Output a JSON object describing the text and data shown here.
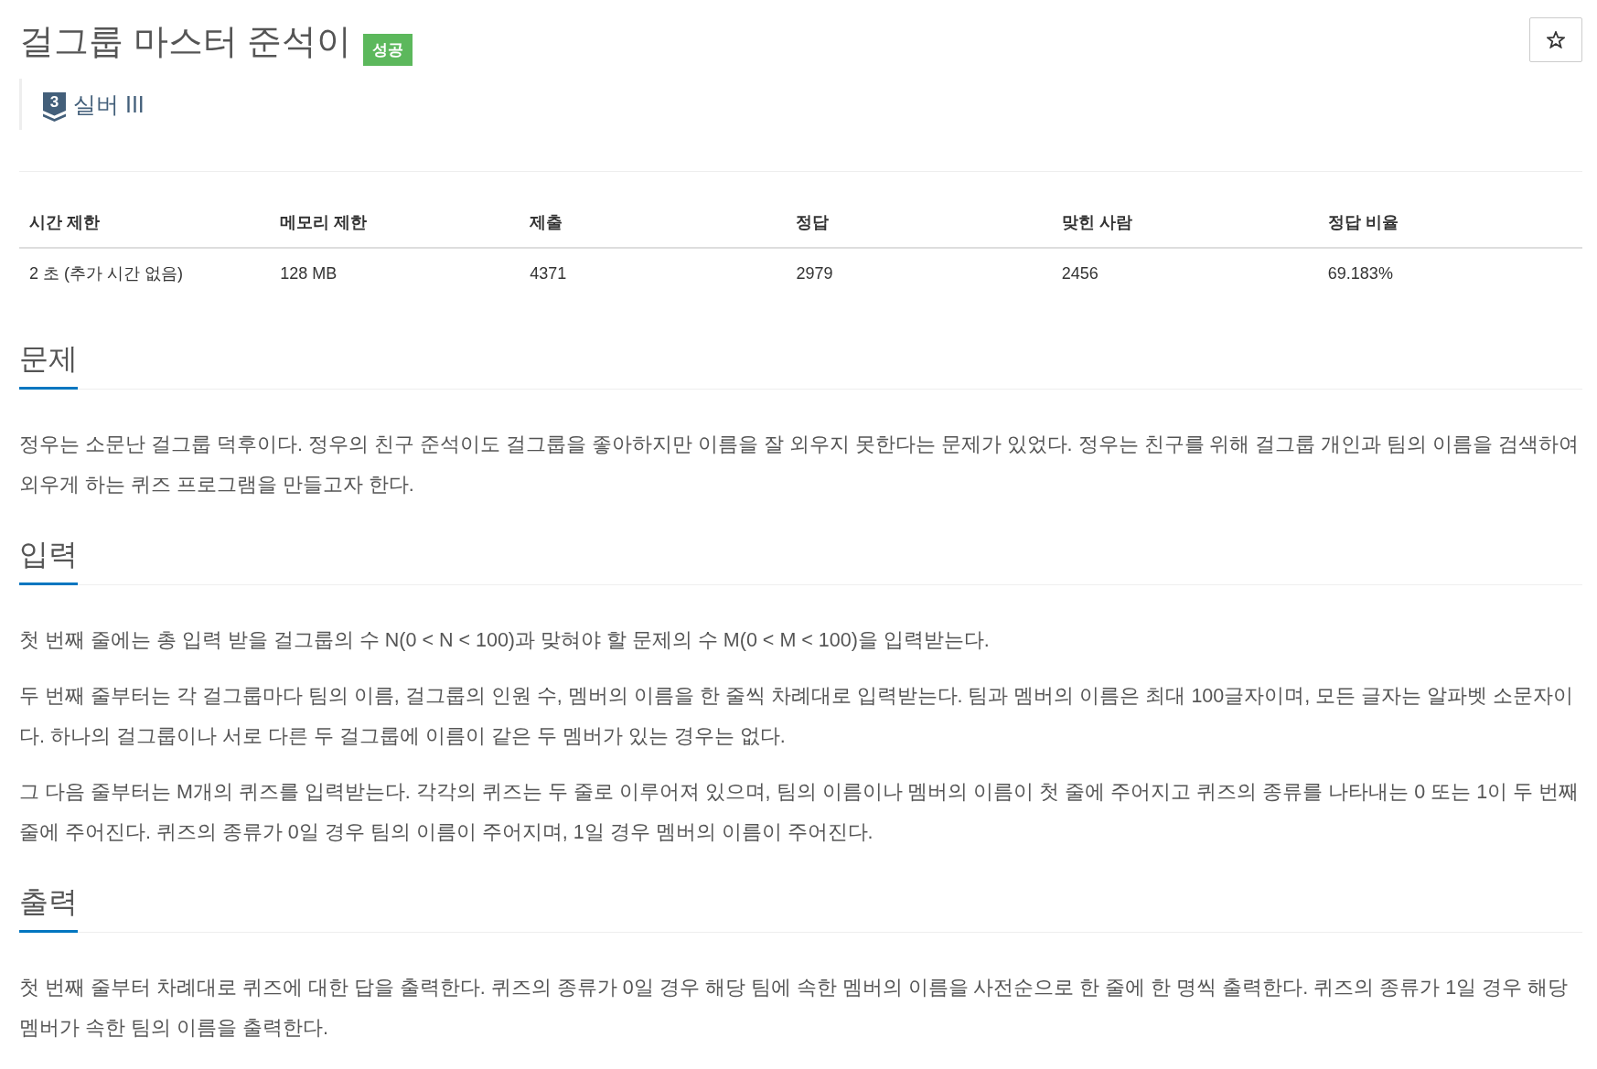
{
  "title": "걸그룹 마스터 준석이",
  "result_badge": "성공",
  "starred": false,
  "tier": {
    "number": "3",
    "label": "실버 III"
  },
  "stats": {
    "columns": [
      "시간 제한",
      "메모리 제한",
      "제출",
      "정답",
      "맞힌 사람",
      "정답 비율"
    ],
    "rows": [
      [
        "2 초 (추가 시간 없음)",
        "128 MB",
        "4371",
        "2979",
        "2456",
        "69.183%"
      ]
    ]
  },
  "sections": [
    {
      "heading": "문제",
      "paragraphs": [
        "정우는 소문난 걸그룹 덕후이다. 정우의 친구 준석이도 걸그룹을 좋아하지만 이름을 잘 외우지 못한다는 문제가 있었다. 정우는 친구를 위해 걸그룹 개인과 팀의 이름을 검색하여 외우게 하는 퀴즈 프로그램을 만들고자 한다."
      ]
    },
    {
      "heading": "입력",
      "paragraphs": [
        "첫 번째 줄에는 총 입력 받을 걸그룹의 수 N(0 < N < 100)과 맞혀야 할 문제의 수 M(0 < M < 100)을 입력받는다.",
        "두 번째 줄부터는 각 걸그룹마다 팀의 이름, 걸그룹의 인원 수, 멤버의 이름을 한 줄씩 차례대로 입력받는다. 팀과 멤버의 이름은 최대 100글자이며, 모든 글자는 알파벳 소문자이다. 하나의 걸그룹이나 서로 다른 두 걸그룹에 이름이 같은 두 멤버가 있는 경우는 없다.",
        "그 다음 줄부터는 M개의 퀴즈를 입력받는다. 각각의 퀴즈는 두 줄로 이루어져 있으며, 팀의 이름이나 멤버의 이름이 첫 줄에 주어지고 퀴즈의 종류를 나타내는 0 또는 1이 두 번째 줄에 주어진다. 퀴즈의 종류가 0일 경우 팀의 이름이 주어지며, 1일 경우 멤버의 이름이 주어진다."
      ]
    },
    {
      "heading": "출력",
      "paragraphs": [
        "첫 번째 줄부터 차례대로 퀴즈에 대한 답을 출력한다. 퀴즈의 종류가 0일 경우 해당 팀에 속한 멤버의 이름을 사전순으로 한 줄에 한 명씩 출력한다. 퀴즈의 종류가 1일 경우 해당 멤버가 속한 팀의 이름을 출력한다."
      ]
    }
  ]
}
